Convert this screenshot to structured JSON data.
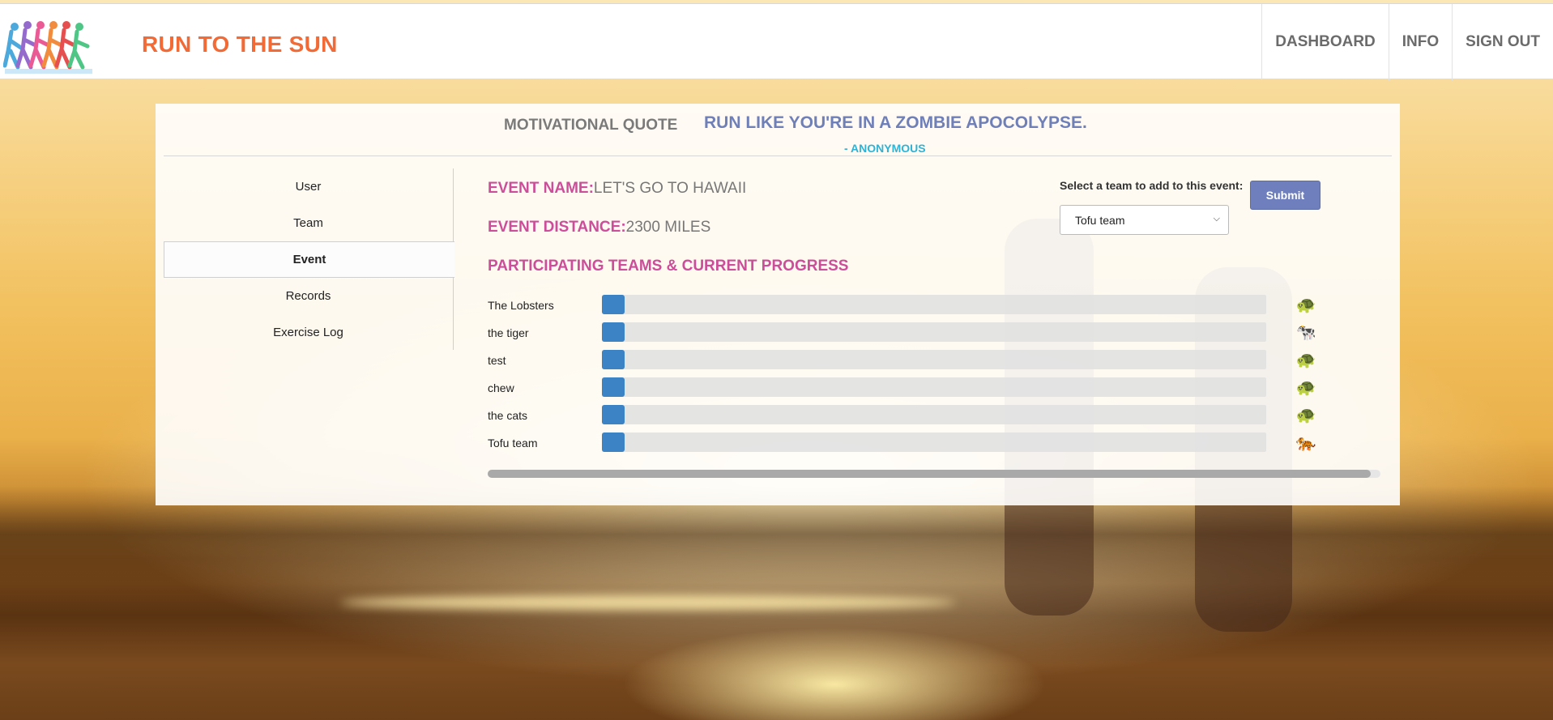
{
  "app": {
    "title": "RUN TO THE SUN"
  },
  "nav": {
    "items": [
      {
        "label": "DASHBOARD"
      },
      {
        "label": "INFO"
      },
      {
        "label": "SIGN OUT"
      }
    ]
  },
  "quote": {
    "label": "MOTIVATIONAL QUOTE",
    "text": "RUN LIKE YOU'RE IN A ZOMBIE APOCOLYPSE.",
    "author": "- ANONYMOUS"
  },
  "sidebar": {
    "items": [
      {
        "label": "User",
        "active": false
      },
      {
        "label": "Team",
        "active": false
      },
      {
        "label": "Event",
        "active": true
      },
      {
        "label": "Records",
        "active": false
      },
      {
        "label": "Exercise Log",
        "active": false
      }
    ]
  },
  "event": {
    "name_label": "EVENT NAME:",
    "name": "LET'S GO TO HAWAII",
    "distance_label": "EVENT DISTANCE:",
    "distance": "2300 MILES",
    "progress_title": "PARTICIPATING TEAMS & CURRENT PROGRESS"
  },
  "add_team": {
    "label": "Select a team to add to this event:",
    "selected": "Tofu team",
    "submit_label": "Submit"
  },
  "teams": [
    {
      "name": "The Lobsters",
      "progress": 0.0,
      "mascot": "turtle-icon",
      "glyph": "🐢"
    },
    {
      "name": "the tiger",
      "progress": 0.0,
      "mascot": "cow-icon",
      "glyph": "🐄"
    },
    {
      "name": "test",
      "progress": 0.0,
      "mascot": "turtle-icon",
      "glyph": "🐢"
    },
    {
      "name": "chew",
      "progress": 0.0,
      "mascot": "turtle-icon",
      "glyph": "🐢"
    },
    {
      "name": "the cats",
      "progress": 0.0,
      "mascot": "turtle-icon",
      "glyph": "🐢"
    },
    {
      "name": "Tofu team",
      "progress": 0.0,
      "mascot": "tiger-icon",
      "glyph": "🐅"
    }
  ],
  "colors": {
    "brand": "#f26a36",
    "accent_pink": "#cc4d99",
    "quote_blue": "#6f7fb8",
    "author_cyan": "#2eb3d6",
    "progress_fill": "#3b83c4",
    "submit_bg": "#6f7fbd"
  }
}
